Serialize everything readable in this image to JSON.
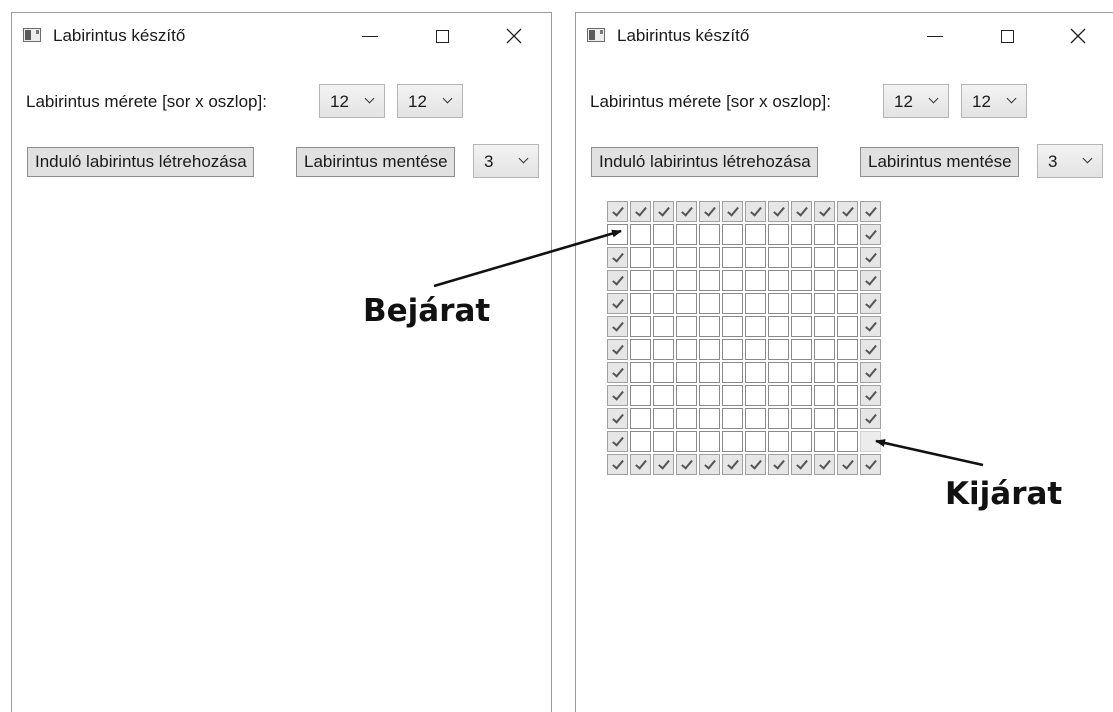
{
  "windows": [
    {
      "title": "Labirintus készítő",
      "size_label": "Labirintus mérete [sor x oszlop]:",
      "rows_value": "12",
      "cols_value": "12",
      "create_button": "Induló labirintus létrehozása",
      "save_button": "Labirintus mentése",
      "third_value": "3"
    },
    {
      "title": "Labirintus készítő",
      "size_label": "Labirintus mérete [sor x oszlop]:",
      "rows_value": "12",
      "cols_value": "12",
      "create_button": "Induló labirintus létrehozása",
      "save_button": "Labirintus mentése",
      "third_value": "3"
    }
  ],
  "maze": {
    "rows": 12,
    "cols": 12,
    "grid": [
      "111111111111",
      "000000000001",
      "100000000001",
      "100000000001",
      "100000000001",
      "100000000001",
      "100000000001",
      "100000000001",
      "100000000001",
      "100000000001",
      "10000000000b",
      "111111111111"
    ]
  },
  "annotations": {
    "entrance": "Bejárat",
    "exit": "Kijárat"
  }
}
